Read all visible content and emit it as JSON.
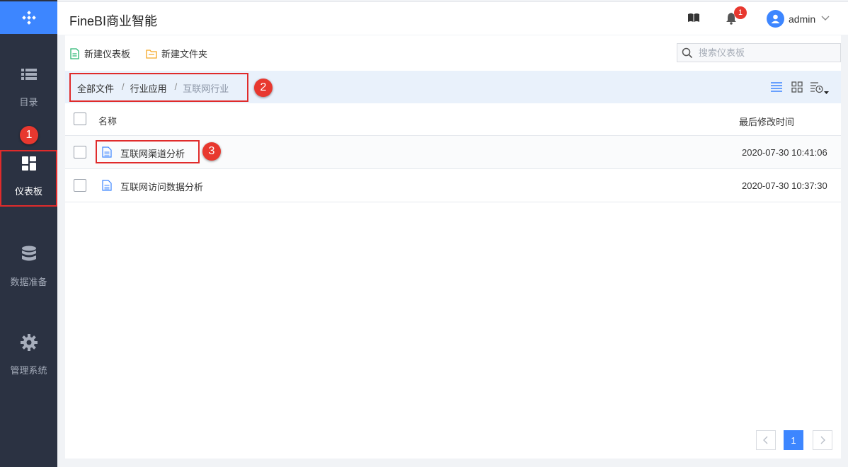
{
  "app": {
    "title": "FineBI商业智能"
  },
  "header": {
    "user": "admin",
    "notification_count": "1"
  },
  "sidebar": {
    "items": [
      {
        "label": "目录",
        "icon": "list-icon",
        "active": false
      },
      {
        "label": "仪表板",
        "icon": "dashboard-grid-icon",
        "active": true
      },
      {
        "label": "数据准备",
        "icon": "database-icon",
        "active": false
      },
      {
        "label": "管理系统",
        "icon": "gear-icon",
        "active": false
      }
    ]
  },
  "toolbar": {
    "new_dashboard": "新建仪表板",
    "new_folder": "新建文件夹",
    "search_placeholder": "搜索仪表板"
  },
  "breadcrumb": {
    "items": [
      "全部文件",
      "行业应用",
      "互联网行业"
    ],
    "separator": "/"
  },
  "table": {
    "columns": {
      "name": "名称",
      "modified": "最后修改时间"
    },
    "rows": [
      {
        "name": "互联网渠道分析",
        "modified": "2020-07-30 10:41:06"
      },
      {
        "name": "互联网访问数据分析",
        "modified": "2020-07-30 10:37:30"
      }
    ]
  },
  "pagination": {
    "current_page": "1"
  },
  "annotations": [
    "1",
    "2",
    "3"
  ],
  "colors": {
    "accent": "#3d86ff",
    "sidebar": "#2b3242",
    "annotation": "#e02b2b"
  }
}
